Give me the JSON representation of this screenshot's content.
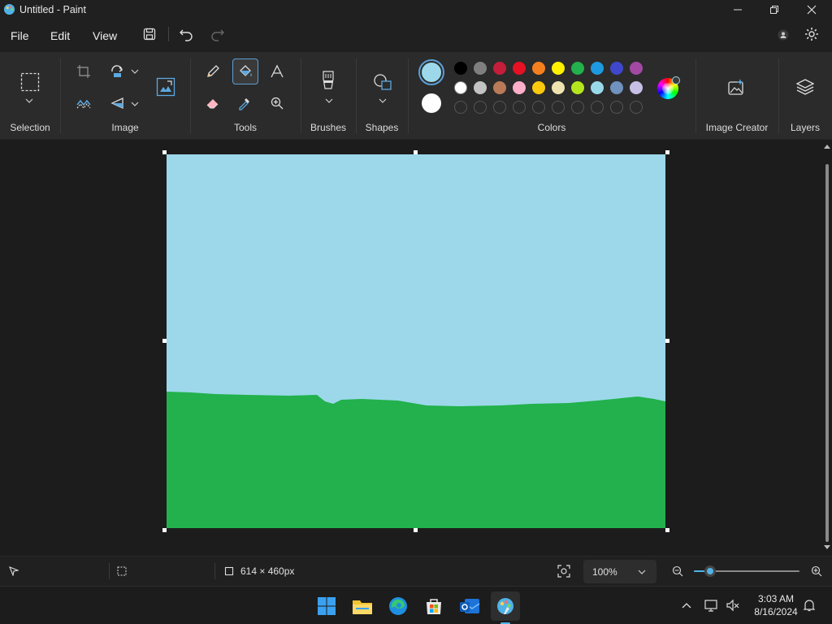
{
  "window": {
    "title": "Untitled - Paint"
  },
  "menu": {
    "file": "File",
    "edit": "Edit",
    "view": "View"
  },
  "ribbon": {
    "groups": {
      "selection": "Selection",
      "image": "Image",
      "tools": "Tools",
      "brushes": "Brushes",
      "shapes": "Shapes",
      "colors": "Colors",
      "image_creator": "Image Creator",
      "layers": "Layers"
    },
    "active_tool": "fill-bucket",
    "primary_color": "#9cd8ea",
    "secondary_color": "#ffffff",
    "palette_row1": [
      "#000000",
      "#7f7f7f",
      "#c41e3a",
      "#e81123",
      "#f7801e",
      "#fff100",
      "#22b14c",
      "#1e9ae0",
      "#3f48cc",
      "#a349a4"
    ],
    "palette_row2": [
      "#ffffff",
      "#c3c3c3",
      "#b97a57",
      "#ffaec9",
      "#ffc90e",
      "#efe4b0",
      "#b5e61d",
      "#99d9ea",
      "#7092be",
      "#c8bfe7"
    ]
  },
  "canvas": {
    "sky_color": "#9cd8ea",
    "grass_color": "#22b14c"
  },
  "status": {
    "canvas_size": "614 × 460px",
    "zoom": "100%",
    "zoom_slider_value": 0.15
  },
  "taskbar": {
    "time": "3:03 AM",
    "date": "8/16/2024"
  }
}
